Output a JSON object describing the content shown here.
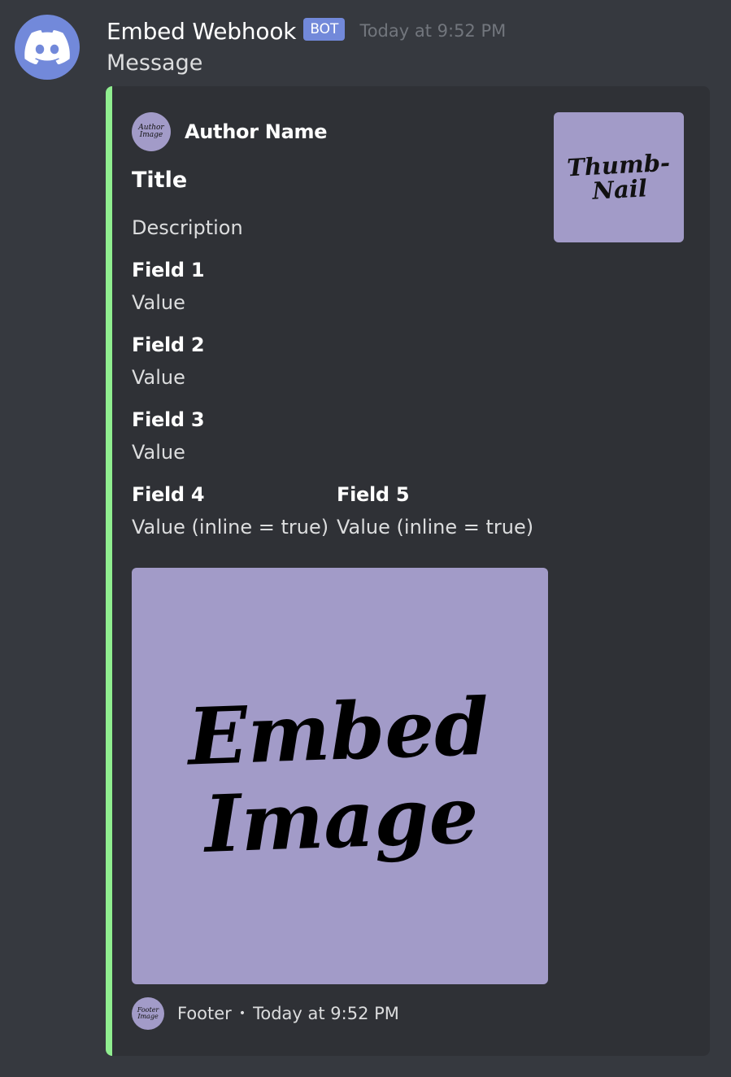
{
  "message": {
    "username": "Embed Webhook",
    "bot_tag": "BOT",
    "timestamp": "Today at 9:52 PM",
    "content": "Message",
    "avatar_icon": "discord-logo-icon",
    "avatar_color": "#7289da"
  },
  "embed": {
    "color": "#90ee90",
    "author": {
      "name": "Author Name",
      "icon_text_1": "Author",
      "icon_text_2": "Image"
    },
    "title": "Title",
    "description": "Description",
    "fields": [
      {
        "name": "Field 1",
        "value": "Value",
        "inline": false
      },
      {
        "name": "Field 2",
        "value": "Value",
        "inline": false
      },
      {
        "name": "Field 3",
        "value": "Value",
        "inline": false
      },
      {
        "name": "Field 4",
        "value": "Value (inline = true)",
        "inline": true
      },
      {
        "name": "Field 5",
        "value": "Value (inline = true)",
        "inline": true
      }
    ],
    "thumbnail": {
      "text": "Thumb-\nNail"
    },
    "image": {
      "text": "Embed\nImage"
    },
    "footer": {
      "text": "Footer",
      "separator": "•",
      "timestamp": "Today at 9:52 PM",
      "icon_text_1": "Footer",
      "icon_text_2": "Image"
    },
    "image_background": "#a29bc8"
  }
}
